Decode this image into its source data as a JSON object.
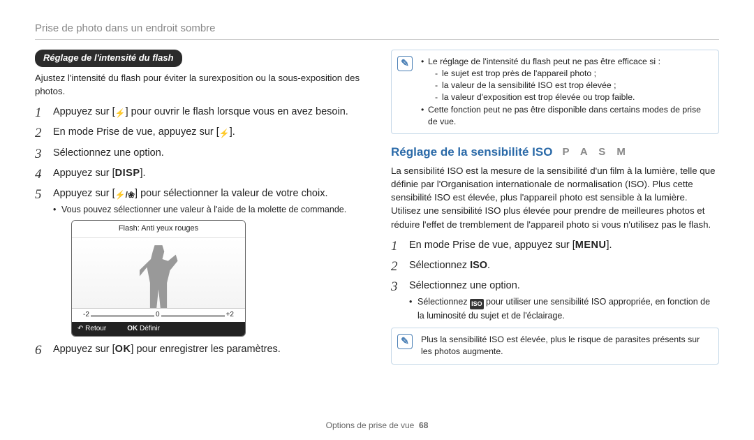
{
  "header": "Prise de photo dans un endroit sombre",
  "left": {
    "pill": "Réglage de l'intensité du flash",
    "intro": "Ajustez l'intensité du flash pour éviter la surexposition ou la sous-exposition des photos.",
    "steps": {
      "s1_a": "Appuyez sur [",
      "s1_b": "] pour ouvrir le flash lorsque vous en avez besoin.",
      "s2_a": "En mode Prise de vue, appuyez sur [",
      "s2_b": "].",
      "s3": "Sélectionnez une option.",
      "s4_a": "Appuyez sur [",
      "s4_key": "DISP",
      "s4_b": "].",
      "s5_a": "Appuyez sur [",
      "s5_b": "] pour sélectionner la valeur de votre choix.",
      "s5_sub": "Vous pouvez sélectionner une valeur à l'aide de la molette de commande.",
      "s6_a": "Appuyez sur [",
      "s6_key": "OK",
      "s6_b": "] pour enregistrer les paramètres."
    },
    "preview": {
      "title": "Flash: Anti yeux rouges",
      "scale_left": "-2",
      "scale_mid": "0",
      "scale_right": "+2",
      "btn_back_icon": "↶",
      "btn_back": "Retour",
      "btn_ok_icon": "OK",
      "btn_ok": "Définir"
    }
  },
  "right": {
    "note1": {
      "line1": "Le réglage de l'intensité du flash peut ne pas être efficace si :",
      "d1": "le sujet est trop près de l'appareil photo ;",
      "d2": "la valeur de la sensibilité ISO est trop élevée ;",
      "d3": "la valeur d'exposition est trop élevée ou trop faible.",
      "line2": "Cette fonction peut ne pas être disponible dans certains modes de prise de vue."
    },
    "heading": "Réglage de la sensibilité ISO",
    "modes": "P A S M",
    "body": "La sensibilité ISO est la mesure de la sensibilité d'un film à la lumière, telle que définie par l'Organisation internationale de normalisation (ISO). Plus cette sensibilité ISO est élevée, plus l'appareil photo est sensible à la lumière. Utilisez une sensibilité ISO plus élevée pour prendre de meilleures photos et réduire l'effet de tremblement de l'appareil photo si vous n'utilisez pas le flash.",
    "steps": {
      "s1_a": "En mode Prise de vue, appuyez sur [",
      "s1_key": "MENU",
      "s1_b": "].",
      "s2_a": "Sélectionnez ",
      "s2_b": "ISO",
      "s2_c": ".",
      "s3": "Sélectionnez une option.",
      "s3_sub_a": "Sélectionnez ",
      "s3_sub_b": " pour utiliser une sensibilité ISO appropriée, en fonction de la luminosité du sujet et de l'éclairage."
    },
    "note2": "Plus la sensibilité ISO est élevée, plus le risque de parasites présents sur les photos augmente."
  },
  "footer": {
    "label": "Options de prise de vue",
    "page": "68"
  }
}
